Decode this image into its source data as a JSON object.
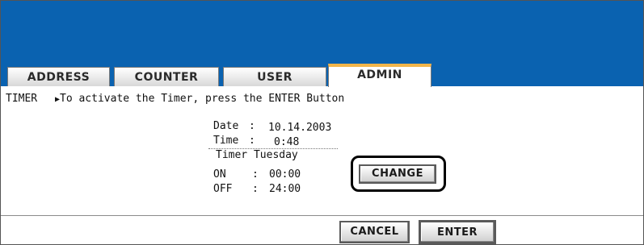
{
  "tabs": [
    {
      "label": "ADDRESS"
    },
    {
      "label": "COUNTER"
    },
    {
      "label": "USER"
    },
    {
      "label": "ADMIN"
    }
  ],
  "info": {
    "section": "TIMER",
    "arrow": "▶",
    "message": "To activate the Timer, press the ENTER Button"
  },
  "timer": {
    "date_label": "Date",
    "date_value": "10.14.2003",
    "time_label": "Time",
    "time_value": "0:48",
    "colon": ":",
    "day_title": "Timer Tuesday",
    "on_label": "ON",
    "on_value": "00:00",
    "off_label": "OFF",
    "off_value": "24:00"
  },
  "buttons": {
    "change": "CHANGE",
    "cancel": "CANCEL",
    "enter": "ENTER"
  },
  "colors": {
    "header": "#0a62b0",
    "active_tab_accent": "#f2b54a"
  }
}
